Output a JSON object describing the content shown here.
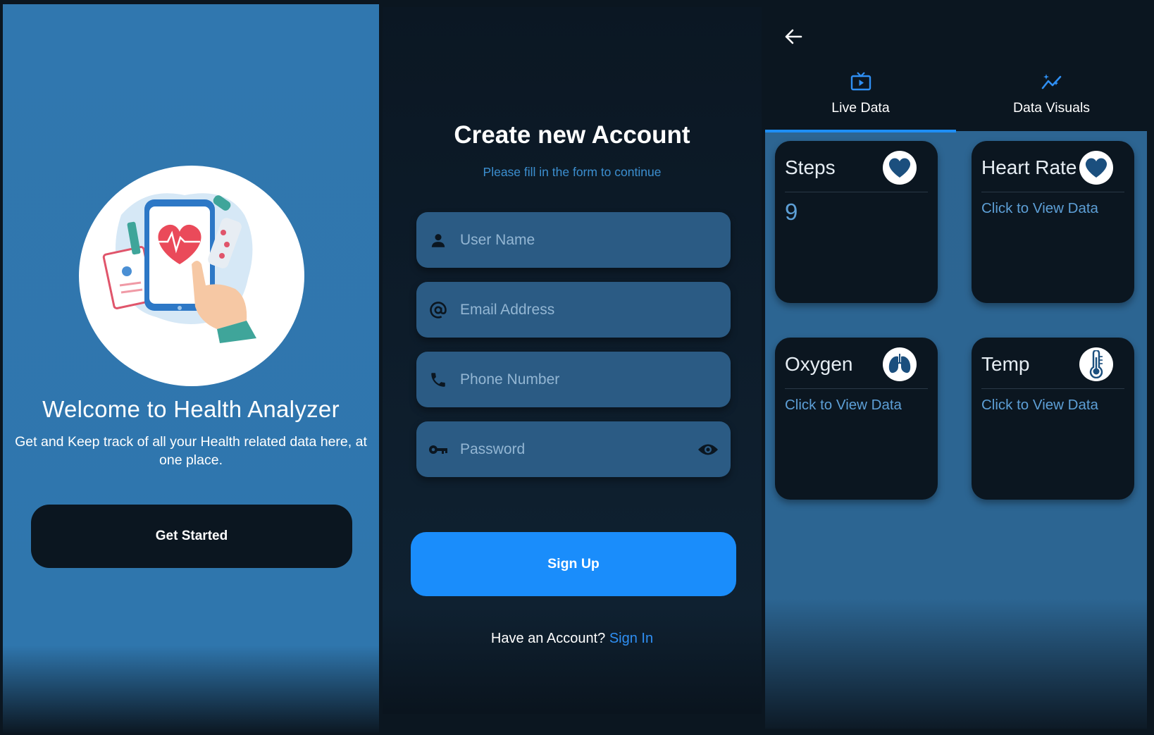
{
  "welcome": {
    "title": "Welcome to Health Analyzer",
    "subtitle": "Get and Keep track of all your Health related data here, at one place.",
    "get_started_label": "Get Started"
  },
  "signup": {
    "title": "Create new Account",
    "subtitle": "Please fill in the form to continue",
    "fields": {
      "username_placeholder": "User Name",
      "email_placeholder": "Email Address",
      "phone_placeholder": "Phone Number",
      "password_placeholder": "Password"
    },
    "signup_label": "Sign Up",
    "have_account_text": "Have an Account?",
    "signin_link": "Sign In"
  },
  "dashboard": {
    "tabs": [
      {
        "label": "Live Data",
        "icon": "live-tv-icon",
        "active": true
      },
      {
        "label": "Data Visuals",
        "icon": "auto-graph-icon",
        "active": false
      }
    ],
    "cards": [
      {
        "title": "Steps",
        "icon": "heart-icon",
        "value": "9"
      },
      {
        "title": "Heart Rate",
        "icon": "heart-icon",
        "link": "Click to View Data"
      },
      {
        "title": "Oxygen",
        "icon": "lungs-icon",
        "link": "Click to View Data"
      },
      {
        "title": "Temp",
        "icon": "thermometer-icon",
        "link": "Click to View Data"
      }
    ]
  },
  "colors": {
    "welcome_bg": "#3077af",
    "dark_bg": "#0b1620",
    "field_bg": "#2b5b84",
    "accent_blue": "#1a8dfb",
    "link_blue": "#5d9fd6",
    "dashboard_bg": "#2d6592"
  }
}
